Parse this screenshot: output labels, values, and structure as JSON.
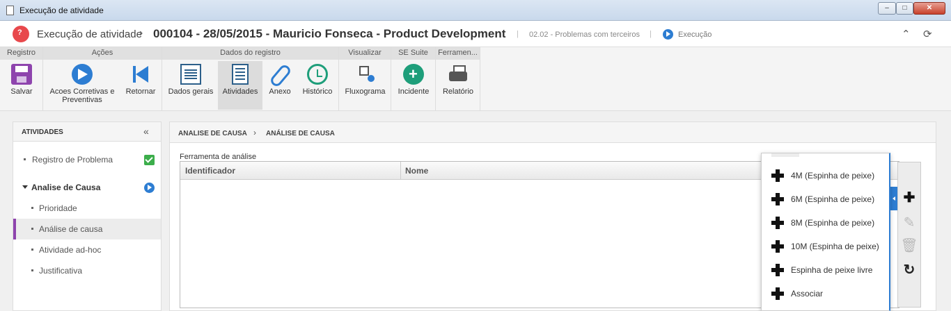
{
  "window": {
    "title": "Execução de atividade",
    "min_icon": "minimize-icon",
    "max_icon": "maximize-icon",
    "close_icon": "close-icon"
  },
  "header": {
    "module": "Execução de atividade",
    "record": "000104 - 28/05/2015 - Mauricio Fonseca - Product Development",
    "subtitle": "02.02 - Problemas com terceiros",
    "status": "Execução",
    "collapse_glyph": "⌃",
    "refresh_glyph": "⟳"
  },
  "ribbon": {
    "groups": [
      {
        "title": "Registro"
      },
      {
        "title": "Ações"
      },
      {
        "title": "Dados do registro"
      },
      {
        "title": "Visualizar"
      },
      {
        "title": "SE Suite"
      },
      {
        "title": "Ferramen..."
      }
    ],
    "buttons": {
      "save": "Salvar",
      "corrective_1": "Acoes Corretivas e",
      "corrective_2": "Preventivas",
      "return": "Retornar",
      "general": "Dados gerais",
      "activities": "Atividades",
      "attachment": "Anexo",
      "history": "Histórico",
      "flowchart": "Fluxograma",
      "incident": "Incidente",
      "report": "Relatório"
    }
  },
  "left_panel": {
    "title": "ATIVIDADES",
    "collapse_glyph": "«",
    "items": [
      {
        "label": "Registro de Problema"
      },
      {
        "label": "Analise de Causa"
      },
      {
        "label": "Prioridade"
      },
      {
        "label": "Análise de causa"
      },
      {
        "label": "Atividade ad-hoc"
      },
      {
        "label": "Justificativa"
      }
    ]
  },
  "main": {
    "breadcrumb": [
      "ANALISE DE CAUSA",
      "ANÁLISE DE CAUSA"
    ],
    "breadcrumb_sep": "›",
    "field_label": "Ferramenta de análise",
    "columns": [
      "Identificador",
      "Nome"
    ]
  },
  "tools": {
    "add": "✚",
    "edit": "✎",
    "delete": "🗑",
    "refresh": "↻"
  },
  "menu": {
    "items": [
      "4M (Espinha de peixe)",
      "6M (Espinha de peixe)",
      "8M (Espinha de peixe)",
      "10M (Espinha de peixe)",
      "Espinha de peixe livre",
      "Associar"
    ]
  },
  "colors": {
    "accent": "#2d7dd2",
    "selection": "#8e44ad",
    "success": "#3cae4b",
    "danger": "#e8484c"
  }
}
